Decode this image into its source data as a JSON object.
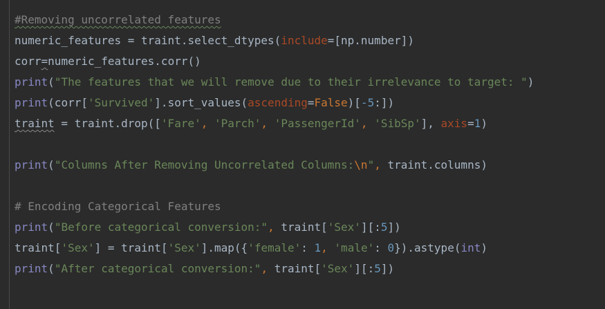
{
  "editor": {
    "lines": [
      [
        {
          "t": "#Removing uncorrelated features",
          "c": "comment squiggle"
        }
      ],
      [
        {
          "t": "numeric_features = traint.select_dtypes(",
          "c": "plain"
        },
        {
          "t": "include",
          "c": "param"
        },
        {
          "t": "=[np.number])",
          "c": "plain"
        }
      ],
      [
        {
          "t": "corr",
          "c": "plain"
        },
        {
          "t": "=",
          "c": "plain squiggle-grey"
        },
        {
          "t": "numeric_features.corr()",
          "c": "plain"
        }
      ],
      [
        {
          "t": "print",
          "c": "builtin"
        },
        {
          "t": "(",
          "c": "plain"
        },
        {
          "t": "\"The features that we will remove due to their irrelevance to target: \"",
          "c": "str"
        },
        {
          "t": ")",
          "c": "plain"
        }
      ],
      [
        {
          "t": "print",
          "c": "builtin"
        },
        {
          "t": "(corr[",
          "c": "plain"
        },
        {
          "t": "'Survived'",
          "c": "str"
        },
        {
          "t": "].sort_values(",
          "c": "plain"
        },
        {
          "t": "ascending",
          "c": "param"
        },
        {
          "t": "=",
          "c": "plain"
        },
        {
          "t": "False",
          "c": "kw"
        },
        {
          "t": ")[",
          "c": "plain"
        },
        {
          "t": "-5",
          "c": "num"
        },
        {
          "t": ":])",
          "c": "plain"
        }
      ],
      [
        {
          "t": "traint",
          "c": "plain squiggle-grey"
        },
        {
          "t": " = traint.drop([",
          "c": "plain"
        },
        {
          "t": "'Fare'",
          "c": "str"
        },
        {
          "t": ", ",
          "c": "kw"
        },
        {
          "t": "'Parch'",
          "c": "str"
        },
        {
          "t": ", ",
          "c": "kw"
        },
        {
          "t": "'PassengerId'",
          "c": "str"
        },
        {
          "t": ", ",
          "c": "kw"
        },
        {
          "t": "'SibSp'",
          "c": "str"
        },
        {
          "t": "], ",
          "c": "plain"
        },
        {
          "t": "axis",
          "c": "param"
        },
        {
          "t": "=",
          "c": "plain"
        },
        {
          "t": "1",
          "c": "num"
        },
        {
          "t": ")",
          "c": "plain"
        }
      ],
      [],
      [
        {
          "t": "print",
          "c": "builtin"
        },
        {
          "t": "(",
          "c": "plain"
        },
        {
          "t": "\"Columns After Removing Uncorrelated Columns:",
          "c": "str"
        },
        {
          "t": "\\n",
          "c": "esc"
        },
        {
          "t": "\"",
          "c": "str"
        },
        {
          "t": ", ",
          "c": "kw"
        },
        {
          "t": "traint.columns)",
          "c": "plain"
        }
      ],
      [],
      [
        {
          "t": "# Encoding Categorical Features",
          "c": "comment"
        }
      ],
      [
        {
          "t": "print",
          "c": "builtin"
        },
        {
          "t": "(",
          "c": "plain"
        },
        {
          "t": "\"Before categorical conversion:\"",
          "c": "str"
        },
        {
          "t": ", ",
          "c": "kw"
        },
        {
          "t": "traint[",
          "c": "plain"
        },
        {
          "t": "'Sex'",
          "c": "str"
        },
        {
          "t": "][:",
          "c": "plain"
        },
        {
          "t": "5",
          "c": "num"
        },
        {
          "t": "])",
          "c": "plain"
        }
      ],
      [
        {
          "t": "traint[",
          "c": "plain"
        },
        {
          "t": "'Sex'",
          "c": "str"
        },
        {
          "t": "] = traint[",
          "c": "plain"
        },
        {
          "t": "'Sex'",
          "c": "str"
        },
        {
          "t": "].map({",
          "c": "plain"
        },
        {
          "t": "'female'",
          "c": "str"
        },
        {
          "t": ": ",
          "c": "plain"
        },
        {
          "t": "1",
          "c": "num"
        },
        {
          "t": ", ",
          "c": "kw"
        },
        {
          "t": "'male'",
          "c": "str"
        },
        {
          "t": ": ",
          "c": "plain"
        },
        {
          "t": "0",
          "c": "num"
        },
        {
          "t": "}).astype(",
          "c": "plain"
        },
        {
          "t": "int",
          "c": "builtin"
        },
        {
          "t": ")",
          "c": "plain"
        }
      ],
      [
        {
          "t": "print",
          "c": "builtin"
        },
        {
          "t": "(",
          "c": "plain"
        },
        {
          "t": "\"After categorical conversion:\"",
          "c": "str"
        },
        {
          "t": ", ",
          "c": "kw"
        },
        {
          "t": "traint[",
          "c": "plain"
        },
        {
          "t": "'Sex'",
          "c": "str"
        },
        {
          "t": "][:",
          "c": "plain"
        },
        {
          "t": "5",
          "c": "num"
        },
        {
          "t": "])",
          "c": "plain"
        }
      ]
    ]
  },
  "theme": {
    "background": "#2b2b2b",
    "text": "#a9b7c6",
    "comment": "#808080",
    "keyword": "#cc7832",
    "builtin": "#8888c6",
    "string": "#6a8759",
    "number": "#6897bb",
    "parameter": "#aa4926"
  }
}
